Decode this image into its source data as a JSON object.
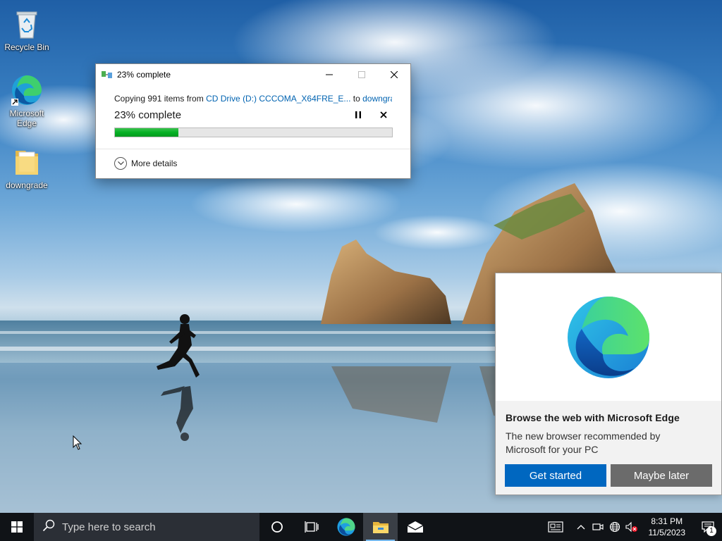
{
  "desktop": {
    "icons": [
      {
        "label": "Recycle Bin"
      },
      {
        "label": "Microsoft Edge"
      },
      {
        "label": "downgrade"
      }
    ]
  },
  "copy_dialog": {
    "title": "23% complete",
    "copying_prefix": "Copying 991 items from ",
    "source": "CD Drive (D:) CCCOMA_X64FRE_E...",
    "to_word": " to ",
    "destination": "downgrade",
    "percent_text": "23% complete",
    "progress_fraction": 0.23,
    "more_details": "More details"
  },
  "edge_promo": {
    "title": "Browse the web with Microsoft Edge",
    "description": "The new browser recommended by Microsoft for your PC",
    "primary_button": "Get started",
    "secondary_button": "Maybe later",
    "primary_color": "#0067c0",
    "secondary_color": "#6b6b6b"
  },
  "taskbar": {
    "search_placeholder": "Type here to search",
    "apps": [
      "cortana-icon",
      "task-view-icon",
      "edge-icon",
      "file-explorer-icon",
      "mail-icon"
    ],
    "clock_time": "8:31 PM",
    "clock_date": "11/5/2023",
    "notification_count": "1"
  },
  "colors": {
    "progress_green": "#06b025",
    "link_blue": "#0063b1",
    "taskbar_bg": "#101317"
  }
}
